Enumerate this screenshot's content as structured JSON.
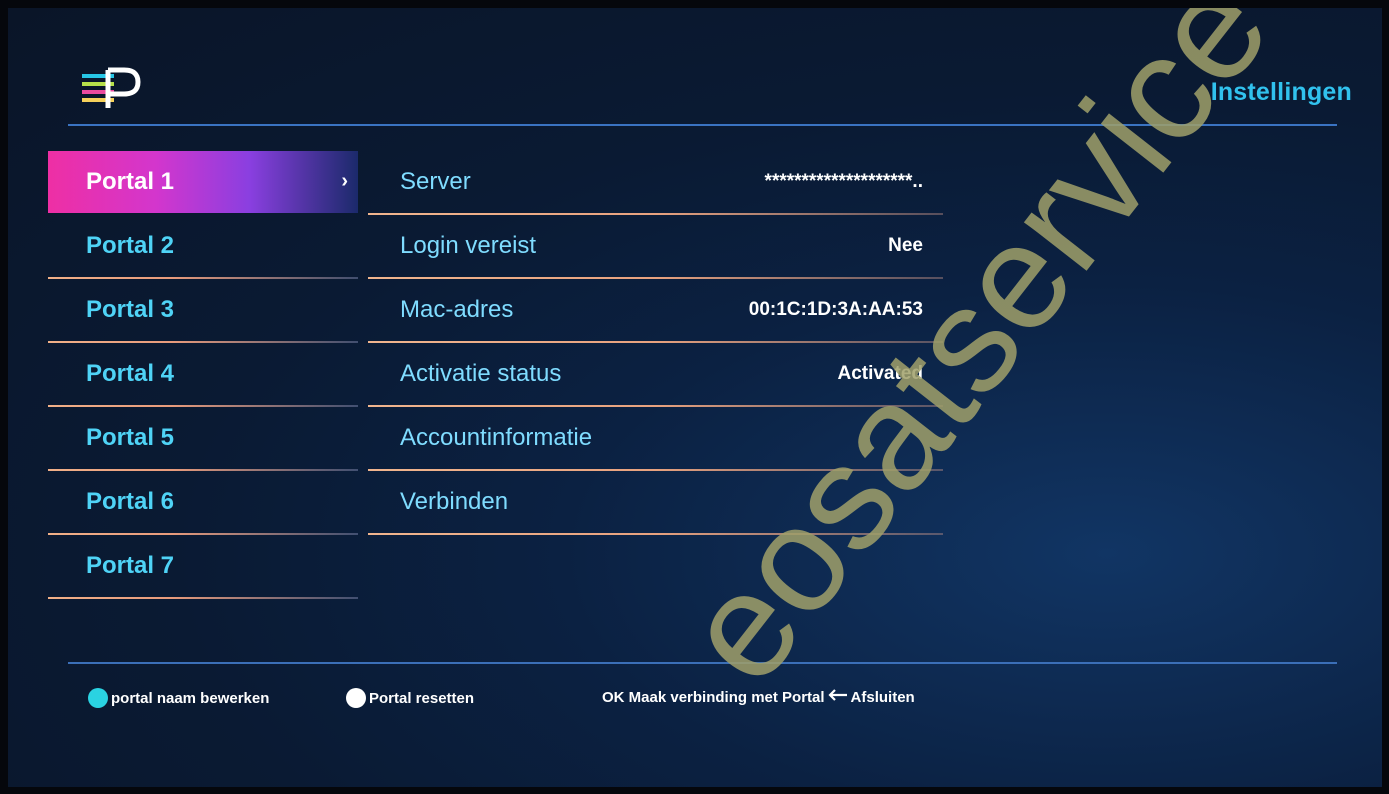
{
  "header": {
    "title": "Instellingen",
    "logo_icon": "app-logo-icon"
  },
  "portals": [
    {
      "label": "Portal 1",
      "active": true
    },
    {
      "label": "Portal 2",
      "active": false
    },
    {
      "label": "Portal 3",
      "active": false
    },
    {
      "label": "Portal 4",
      "active": false
    },
    {
      "label": "Portal 5",
      "active": false
    },
    {
      "label": "Portal 6",
      "active": false
    },
    {
      "label": "Portal 7",
      "active": false
    }
  ],
  "settings": [
    {
      "label": "Server",
      "value": "********************.."
    },
    {
      "label": "Login vereist",
      "value": "Nee"
    },
    {
      "label": "Mac-adres",
      "value": "00:1C:1D:3A:AA:53"
    },
    {
      "label": "Activatie status",
      "value": "Activated"
    },
    {
      "label": "Accountinformatie",
      "value": ""
    },
    {
      "label": "Verbinden",
      "value": ""
    }
  ],
  "footer": {
    "edit_name": "portal naam bewerken",
    "reset": "Portal resetten",
    "connect": "OK Maak verbinding met Portal",
    "exit": "Afsluiten"
  },
  "watermark": "eosatservice",
  "colors": {
    "accent_cyan": "#31c2ee",
    "active_gradient_start": "#ee2fa4",
    "active_gradient_end": "#8a3fe0",
    "separator": "#f0b58e",
    "edit_dot": "#2ad3e2",
    "reset_dot": "#ffffff"
  }
}
